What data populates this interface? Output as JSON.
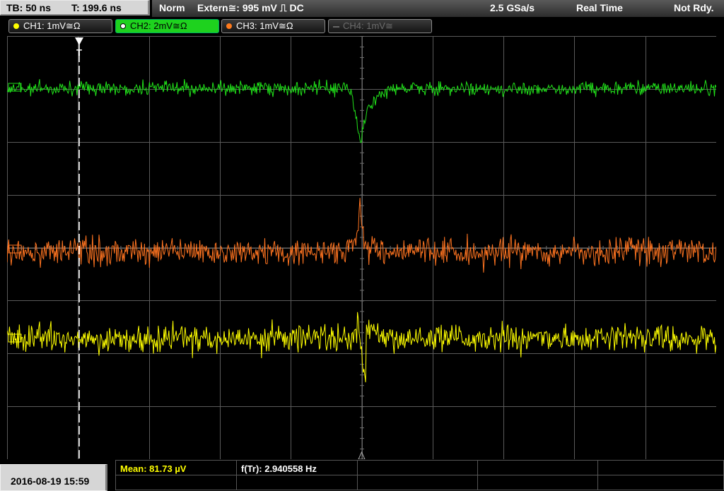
{
  "timebase": {
    "tb": "TB: 50 ns",
    "trigger_time": "T: 199.6 ns"
  },
  "status": {
    "mode": "Norm",
    "trigger_source": "Extern≅: 995 mV ⎍ DC",
    "sample_rate": "2.5 GSa/s",
    "acq_mode": "Real Time",
    "state": "Not Rdy."
  },
  "channels": [
    {
      "label": "CH1: 1mV≅Ω",
      "color": "#ffff00"
    },
    {
      "label": "CH2: 2mV≅Ω",
      "color": "#1ed21e"
    },
    {
      "label": "CH3: 1mV≅Ω",
      "color": "#ff7a1c"
    },
    {
      "label": "CH4: 1mV≅",
      "color": "#777777"
    }
  ],
  "trigger_marker": "T",
  "date": "2016-08-19 15:59",
  "measurements": {
    "mean": "Mean: 81.73 µV",
    "freq": "f(Tr): 2.940558 Hz"
  },
  "colors": {
    "grid": "#5a5a5a",
    "ch1": "#ffff00",
    "ch2": "#21e21a",
    "ch3": "#ff7420"
  }
}
